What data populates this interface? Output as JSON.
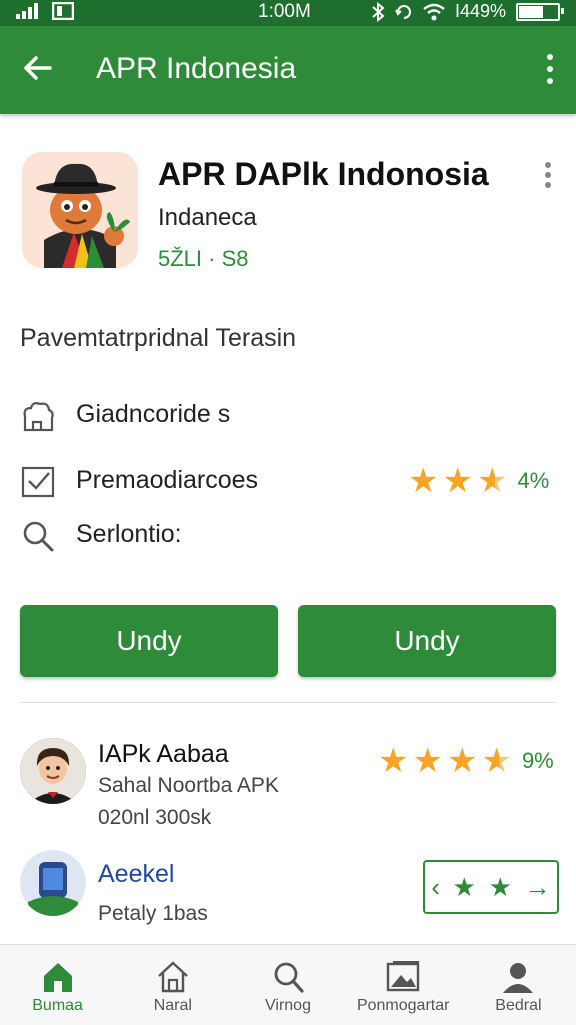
{
  "status_bar": {
    "time": "1:00M",
    "battery": "I449%"
  },
  "app_bar": {
    "title": "APR Indonesia",
    "back_icon": "arrow-left-icon",
    "menu_icon": "more-vert-icon"
  },
  "app": {
    "title": "APR DAPlk Indonosia",
    "subtitle": "Indaneca",
    "meta": "5ŽLI · S8"
  },
  "description": "Pavemtatrpridnal Terasin",
  "rows": [
    {
      "icon": "cloud-house-icon",
      "label": "Giadncoride s"
    },
    {
      "icon": "checkbox-icon",
      "label": "Premaodiarcoes",
      "rating_text": "4%",
      "stars": 2.6
    },
    {
      "icon": "search-icon",
      "label": "Serlontio:"
    }
  ],
  "buttons": {
    "left": "Undy",
    "right": "Undy"
  },
  "list": [
    {
      "title": "IAPk Aabaa",
      "subtitle": "Sahal Noortba APK",
      "meta": "020nl 300sk",
      "rating_text": "9%",
      "stars": 3.7
    },
    {
      "title": "Aeekel",
      "subtitle": "Petaly 1bas"
    }
  ],
  "colors": {
    "primary": "#2e8b3a",
    "status_bar": "#1e6e2e",
    "star": "#f5a623"
  },
  "bottom_nav": [
    {
      "label": "Bumaa",
      "icon": "home-filled-icon",
      "active": true
    },
    {
      "label": "Naral",
      "icon": "home-outline-icon",
      "active": false
    },
    {
      "label": "Virnog",
      "icon": "search-icon",
      "active": false
    },
    {
      "label": "Ponmogartar",
      "icon": "image-icon",
      "active": false
    },
    {
      "label": "Bedral",
      "icon": "person-icon",
      "active": false
    }
  ]
}
